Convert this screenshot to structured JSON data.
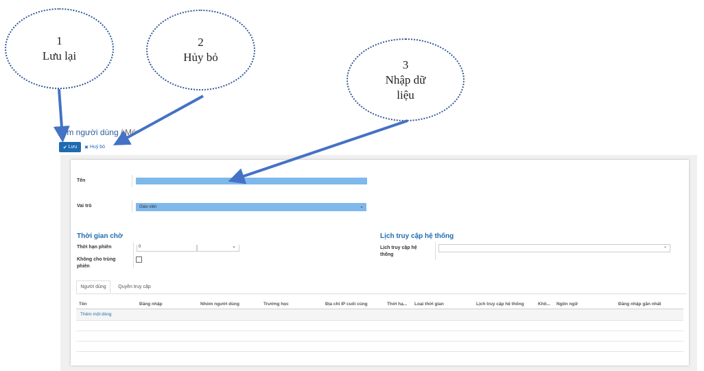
{
  "callouts": [
    {
      "number": "1",
      "text": "Lưu lại"
    },
    {
      "number": "2",
      "text": "Hủy bỏ"
    },
    {
      "number": "3",
      "text": "Nhập dữ liệu"
    }
  ],
  "breadcrumb": {
    "parent": "hóm người dùng",
    "separator": "/",
    "current": "Mớ"
  },
  "toolbar": {
    "save_label": "Lưu",
    "cancel_label": "Huỷ bỏ"
  },
  "form": {
    "name_label": "Tên",
    "name_value": "",
    "role_label": "Vai trò",
    "role_value": "Giáo viên",
    "timeout_section": {
      "title": "Thời gian chờ",
      "session_label": "Thời hạn phiên",
      "session_value": "0",
      "unit_value": "",
      "no_duplicate_label": "Không cho trùng phiên"
    },
    "access_section": {
      "title": "Lịch truy cập hệ thống",
      "field_label": "Lịch truy cập hệ thống",
      "field_value": ""
    }
  },
  "tabs": [
    "Người dùng",
    "Quyền truy cập"
  ],
  "table": {
    "columns": [
      "Tên",
      "Đăng nhập",
      "Nhóm người dùng",
      "Trường học",
      "Địa chỉ IP cuối cùng",
      "Thời hạ...",
      "Loại thời gian",
      "Lịch truy cập hệ thống",
      "Khô...",
      "Ngôn ngữ",
      "Đăng nhập gần nhất"
    ],
    "add_line": "Thêm một dòng"
  },
  "colors": {
    "accent": "#1f6bb0",
    "field_highlight": "#7fb8ea",
    "arrow": "#4472c4",
    "bubble_border": "#2f5597"
  }
}
